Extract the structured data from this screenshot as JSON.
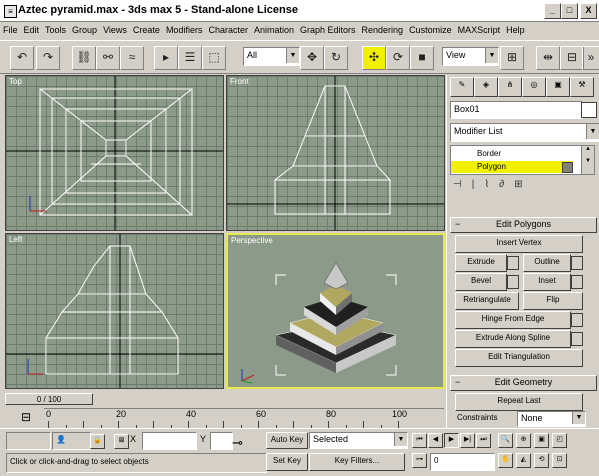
{
  "window": {
    "title": "Aztec pyramid.max - 3ds max 5 - Stand-alone License",
    "minimize": "_",
    "maximize": "□",
    "close": "X"
  },
  "menu": [
    "File",
    "Edit",
    "Tools",
    "Group",
    "Views",
    "Create",
    "Modifiers",
    "Character",
    "Animation",
    "Graph Editors",
    "Rendering",
    "Customize",
    "MAXScript",
    "Help"
  ],
  "toolbar": {
    "selection_filter": "All",
    "ref_coord": "View"
  },
  "viewports": {
    "top": "Top",
    "front": "Front",
    "left": "Left",
    "perspective": "Perspective"
  },
  "command_panel": {
    "object_name": "Box01",
    "modifier_list": "Modifier List",
    "stack": [
      "Border",
      "Polygon"
    ],
    "rollout_edit_polygons": "Edit Polygons",
    "btn_insert_vertex": "Insert Vertex",
    "btn_extrude": "Extrude",
    "btn_outline": "Outline",
    "btn_bevel": "Bevel",
    "btn_inset": "Inset",
    "btn_retriangulate": "Retriangulate",
    "btn_flip": "Flip",
    "btn_hinge": "Hinge From Edge",
    "btn_extrude_spline": "Extrude Along Spline",
    "btn_edit_tri": "Edit Triangulation",
    "rollout_edit_geometry": "Edit Geometry",
    "btn_repeat_last": "Repeat Last",
    "constraints_label": "Constraints",
    "constraints_value": "None"
  },
  "timeline": {
    "slider": "0 / 100",
    "ticks": [
      "0",
      "20",
      "40",
      "60",
      "80",
      "100"
    ]
  },
  "status": {
    "prompt": "Click or click-and-drag to select objects",
    "x_label": "X",
    "y_label": "Y",
    "auto_key": "Auto Key",
    "set_key": "Set Key",
    "selected": "Selected",
    "key_filters": "Key Filters...",
    "frame": "0"
  },
  "colors": {
    "viewport_bg": "#8c9a89",
    "active_border": "#e8e850",
    "selected_stack": "#f0f000"
  }
}
